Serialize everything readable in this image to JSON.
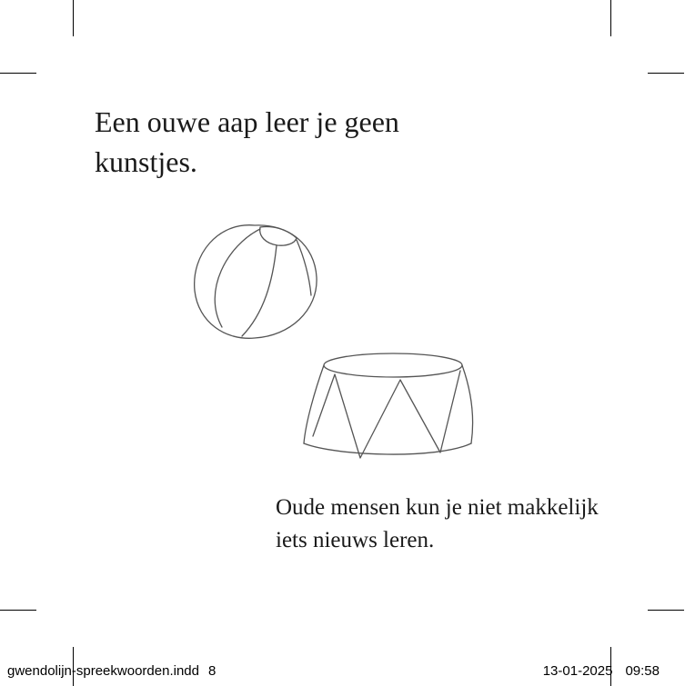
{
  "page": {
    "title": "Een ouwe aap leer je geen kunstjes.",
    "caption": "Oude mensen kun je niet makkelijk iets nieuws leren."
  },
  "footer": {
    "filename": "gwendolijn-spreekwoorden.indd",
    "page_number": "8",
    "date": "13-01-2025",
    "time": "09:58"
  }
}
